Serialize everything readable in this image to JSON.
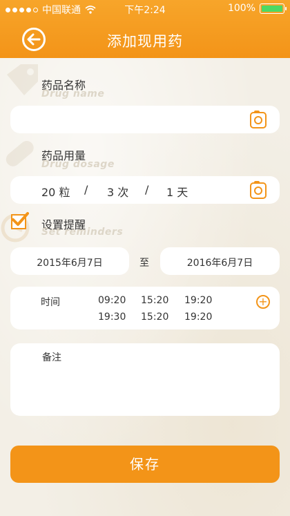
{
  "status_bar": {
    "carrier": "中国联通",
    "time": "下午2:24",
    "battery": "100%"
  },
  "header": {
    "title": "添加现用药"
  },
  "drug_name": {
    "label_cn": "药品名称",
    "label_en": "Drug name",
    "value": ""
  },
  "dosage": {
    "label_cn": "药品用量",
    "label_en": "Drug dosage",
    "amount": "20 粒",
    "times": "3 次",
    "days": "1 天",
    "separator": "/"
  },
  "reminder": {
    "checked": true,
    "label_cn": "设置提醒",
    "label_en": "Set reminders",
    "start_date": "2015年6月7日",
    "to": "至",
    "end_date": "2016年6月7日"
  },
  "time_section": {
    "label": "时间",
    "row1": [
      "09:20",
      "15:20",
      "19:20"
    ],
    "row2": [
      "19:30",
      "15:20",
      "19:20"
    ]
  },
  "note": {
    "label": "备注"
  },
  "save_button": {
    "label": "保存"
  },
  "colors": {
    "accent": "#f39418",
    "background": "#f3efe6"
  },
  "icons": {
    "back": "arrow-left-circle-icon",
    "camera": "camera-icon",
    "plus": "plus-circle-icon",
    "check": "check-icon"
  }
}
